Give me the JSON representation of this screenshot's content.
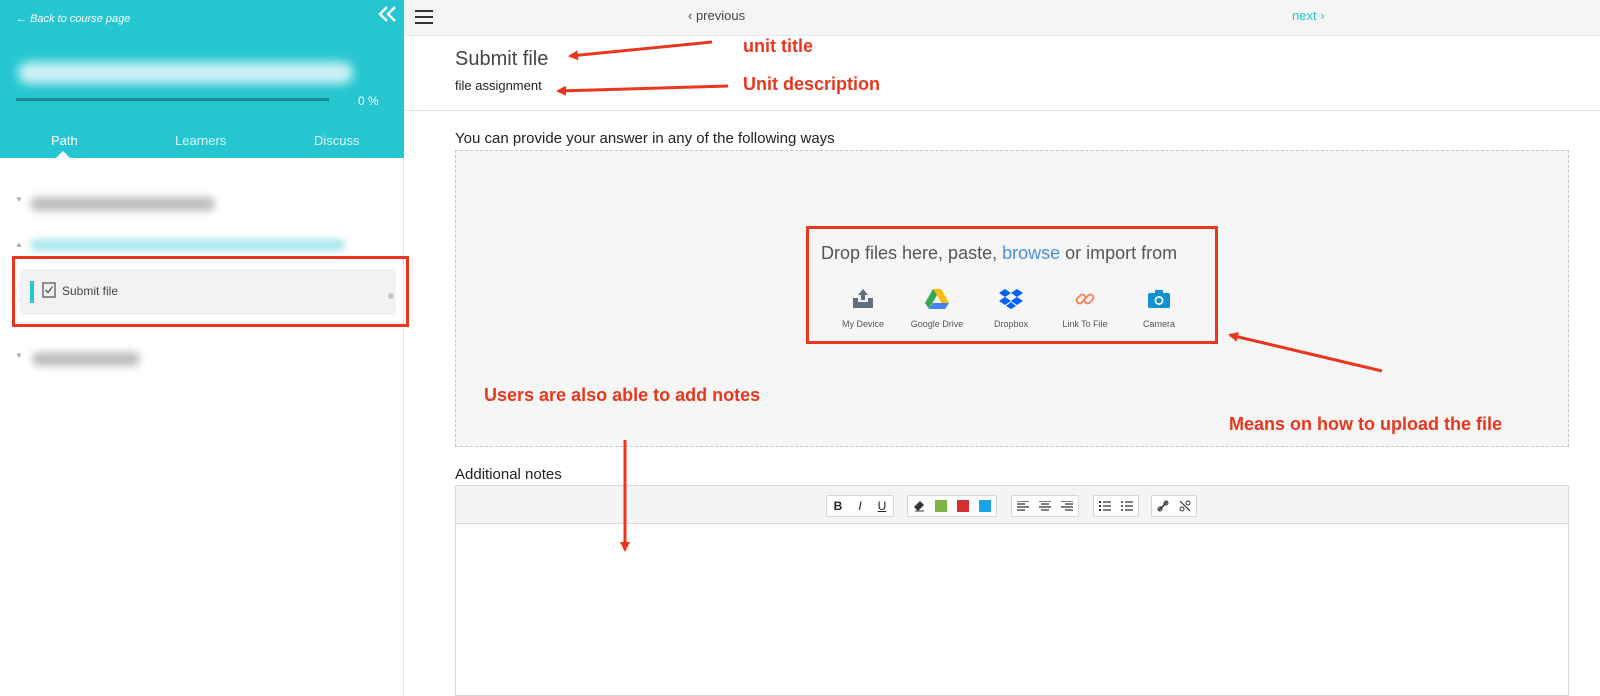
{
  "sidebar": {
    "back_link": "Back to course page",
    "progress_percent": 0,
    "progress_label": "0 %",
    "tabs": [
      {
        "label": "Path"
      },
      {
        "label": "Learners"
      },
      {
        "label": "Discuss"
      }
    ],
    "active_unit": "Submit file"
  },
  "topbar": {
    "previous": "previous",
    "next": "next"
  },
  "main": {
    "unit_title": "Submit file",
    "unit_description": "file assignment",
    "prompt": "You can provide your answer in any of the following ways",
    "drop": {
      "lead": "Drop files here, paste,",
      "browse": "browse",
      "tail": "or import from"
    },
    "sources": [
      {
        "label": "My Device",
        "icon": "upload-tray-icon"
      },
      {
        "label": "Google Drive",
        "icon": "google-drive-icon"
      },
      {
        "label": "Dropbox",
        "icon": "dropbox-icon"
      },
      {
        "label": "Link To File",
        "icon": "link-icon"
      },
      {
        "label": "Camera",
        "icon": "camera-icon"
      }
    ],
    "notes_label": "Additional notes",
    "toolbar": {
      "bold": "B",
      "italic": "I",
      "underline": "U",
      "colors": [
        "#7cb342",
        "#d32f2f",
        "#1ca3e8"
      ]
    }
  },
  "annotations": {
    "unit_title": "unit title",
    "unit_description": "Unit description",
    "notes": "Users are also able to add notes",
    "upload": "Means on how to upload the file"
  },
  "colors": {
    "accent": "#26c6d0",
    "annotation": "#e8371d",
    "link": "#4a90e2"
  }
}
